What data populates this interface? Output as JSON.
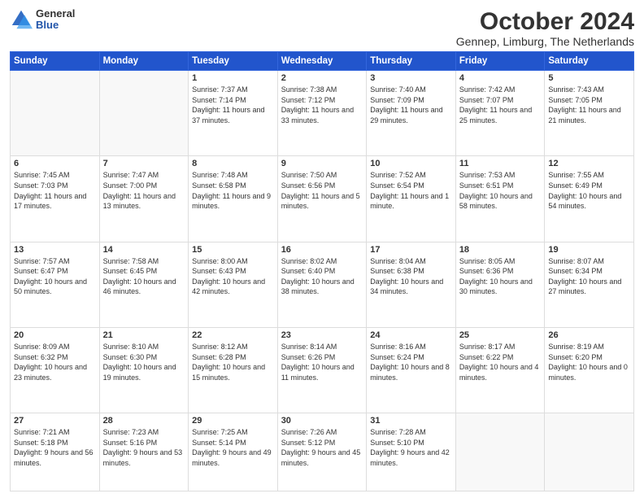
{
  "header": {
    "logo_general": "General",
    "logo_blue": "Blue",
    "title": "October 2024",
    "subtitle": "Gennep, Limburg, The Netherlands"
  },
  "days_of_week": [
    "Sunday",
    "Monday",
    "Tuesday",
    "Wednesday",
    "Thursday",
    "Friday",
    "Saturday"
  ],
  "weeks": [
    [
      {
        "day": "",
        "info": ""
      },
      {
        "day": "",
        "info": ""
      },
      {
        "day": "1",
        "info": "Sunrise: 7:37 AM\nSunset: 7:14 PM\nDaylight: 11 hours and 37 minutes."
      },
      {
        "day": "2",
        "info": "Sunrise: 7:38 AM\nSunset: 7:12 PM\nDaylight: 11 hours and 33 minutes."
      },
      {
        "day": "3",
        "info": "Sunrise: 7:40 AM\nSunset: 7:09 PM\nDaylight: 11 hours and 29 minutes."
      },
      {
        "day": "4",
        "info": "Sunrise: 7:42 AM\nSunset: 7:07 PM\nDaylight: 11 hours and 25 minutes."
      },
      {
        "day": "5",
        "info": "Sunrise: 7:43 AM\nSunset: 7:05 PM\nDaylight: 11 hours and 21 minutes."
      }
    ],
    [
      {
        "day": "6",
        "info": "Sunrise: 7:45 AM\nSunset: 7:03 PM\nDaylight: 11 hours and 17 minutes."
      },
      {
        "day": "7",
        "info": "Sunrise: 7:47 AM\nSunset: 7:00 PM\nDaylight: 11 hours and 13 minutes."
      },
      {
        "day": "8",
        "info": "Sunrise: 7:48 AM\nSunset: 6:58 PM\nDaylight: 11 hours and 9 minutes."
      },
      {
        "day": "9",
        "info": "Sunrise: 7:50 AM\nSunset: 6:56 PM\nDaylight: 11 hours and 5 minutes."
      },
      {
        "day": "10",
        "info": "Sunrise: 7:52 AM\nSunset: 6:54 PM\nDaylight: 11 hours and 1 minute."
      },
      {
        "day": "11",
        "info": "Sunrise: 7:53 AM\nSunset: 6:51 PM\nDaylight: 10 hours and 58 minutes."
      },
      {
        "day": "12",
        "info": "Sunrise: 7:55 AM\nSunset: 6:49 PM\nDaylight: 10 hours and 54 minutes."
      }
    ],
    [
      {
        "day": "13",
        "info": "Sunrise: 7:57 AM\nSunset: 6:47 PM\nDaylight: 10 hours and 50 minutes."
      },
      {
        "day": "14",
        "info": "Sunrise: 7:58 AM\nSunset: 6:45 PM\nDaylight: 10 hours and 46 minutes."
      },
      {
        "day": "15",
        "info": "Sunrise: 8:00 AM\nSunset: 6:43 PM\nDaylight: 10 hours and 42 minutes."
      },
      {
        "day": "16",
        "info": "Sunrise: 8:02 AM\nSunset: 6:40 PM\nDaylight: 10 hours and 38 minutes."
      },
      {
        "day": "17",
        "info": "Sunrise: 8:04 AM\nSunset: 6:38 PM\nDaylight: 10 hours and 34 minutes."
      },
      {
        "day": "18",
        "info": "Sunrise: 8:05 AM\nSunset: 6:36 PM\nDaylight: 10 hours and 30 minutes."
      },
      {
        "day": "19",
        "info": "Sunrise: 8:07 AM\nSunset: 6:34 PM\nDaylight: 10 hours and 27 minutes."
      }
    ],
    [
      {
        "day": "20",
        "info": "Sunrise: 8:09 AM\nSunset: 6:32 PM\nDaylight: 10 hours and 23 minutes."
      },
      {
        "day": "21",
        "info": "Sunrise: 8:10 AM\nSunset: 6:30 PM\nDaylight: 10 hours and 19 minutes."
      },
      {
        "day": "22",
        "info": "Sunrise: 8:12 AM\nSunset: 6:28 PM\nDaylight: 10 hours and 15 minutes."
      },
      {
        "day": "23",
        "info": "Sunrise: 8:14 AM\nSunset: 6:26 PM\nDaylight: 10 hours and 11 minutes."
      },
      {
        "day": "24",
        "info": "Sunrise: 8:16 AM\nSunset: 6:24 PM\nDaylight: 10 hours and 8 minutes."
      },
      {
        "day": "25",
        "info": "Sunrise: 8:17 AM\nSunset: 6:22 PM\nDaylight: 10 hours and 4 minutes."
      },
      {
        "day": "26",
        "info": "Sunrise: 8:19 AM\nSunset: 6:20 PM\nDaylight: 10 hours and 0 minutes."
      }
    ],
    [
      {
        "day": "27",
        "info": "Sunrise: 7:21 AM\nSunset: 5:18 PM\nDaylight: 9 hours and 56 minutes."
      },
      {
        "day": "28",
        "info": "Sunrise: 7:23 AM\nSunset: 5:16 PM\nDaylight: 9 hours and 53 minutes."
      },
      {
        "day": "29",
        "info": "Sunrise: 7:25 AM\nSunset: 5:14 PM\nDaylight: 9 hours and 49 minutes."
      },
      {
        "day": "30",
        "info": "Sunrise: 7:26 AM\nSunset: 5:12 PM\nDaylight: 9 hours and 45 minutes."
      },
      {
        "day": "31",
        "info": "Sunrise: 7:28 AM\nSunset: 5:10 PM\nDaylight: 9 hours and 42 minutes."
      },
      {
        "day": "",
        "info": ""
      },
      {
        "day": "",
        "info": ""
      }
    ]
  ]
}
